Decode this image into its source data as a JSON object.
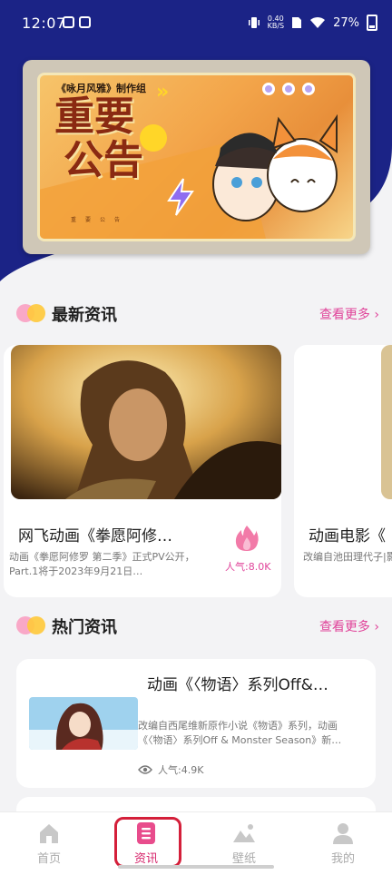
{
  "status_bar": {
    "time": "12:07",
    "net_speed_value": "0.40",
    "net_speed_unit": "KB/S",
    "battery": "27%"
  },
  "banner": {
    "tag": "《咏月风雅》制作组",
    "title_line1": "重要",
    "title_line2": "公告",
    "subtitle": "重要公告"
  },
  "latest_news": {
    "title": "最新资讯",
    "more": "查看更多",
    "cards": [
      {
        "title": "网飞动画《拳愿阿修…",
        "desc": "动画《拳愿阿修罗 第二季》正式PV公开， Part.1将于2023年9月21日…",
        "popularity": "人气:8.0K"
      },
      {
        "title": "动画电影《",
        "desc": "改编自池田理代子|影《凡尔赛玫瑰》将"
      }
    ]
  },
  "hot_news": {
    "title": "热门资讯",
    "more": "查看更多",
    "items": [
      {
        "title": "动画《〈物语〉系列Off&…",
        "desc": "改编自西尾维新原作小说《物语》系列，动画《〈物语〉系列Off & Monster Season》新…",
        "views": "人气:4.9K"
      }
    ]
  },
  "tabbar": {
    "tabs": [
      {
        "label": "首页",
        "icon": "home-icon"
      },
      {
        "label": "资讯",
        "icon": "news-icon",
        "active": true
      },
      {
        "label": "壁纸",
        "icon": "wallpaper-icon"
      },
      {
        "label": "我的",
        "icon": "profile-icon"
      }
    ]
  },
  "colors": {
    "header_navy": "#1b2386",
    "accent_pink": "#e0449a",
    "active_tab": "#d6236a",
    "highlight_red": "#d41f3a"
  }
}
